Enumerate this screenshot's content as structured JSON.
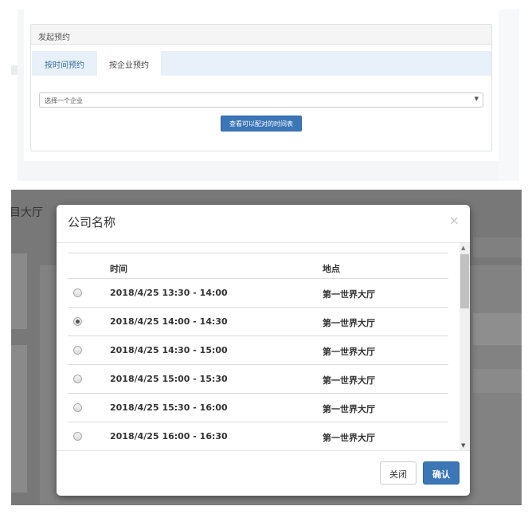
{
  "top": {
    "panel_title": "发起预约",
    "tabs": [
      {
        "label": "按时间预约",
        "active": false
      },
      {
        "label": "按企业预约",
        "active": true
      }
    ],
    "select_placeholder": "选择一个企业",
    "view_button": "查看可以配对的时间表"
  },
  "background": {
    "partial_text": "目大厅"
  },
  "modal": {
    "title": "公司名称",
    "close_icon": "×",
    "headers": {
      "time": "时间",
      "location": "地点"
    },
    "rows": [
      {
        "time": "2018/4/25 13:30 - 14:00",
        "location": "第一世界大厅",
        "selected": false
      },
      {
        "time": "2018/4/25 14:00 - 14:30",
        "location": "第一世界大厅",
        "selected": true
      },
      {
        "time": "2018/4/25 14:30 - 15:00",
        "location": "第一世界大厅",
        "selected": false
      },
      {
        "time": "2018/4/25 15:00 - 15:30",
        "location": "第一世界大厅",
        "selected": false
      },
      {
        "time": "2018/4/25 15:30 - 16:00",
        "location": "第一世界大厅",
        "selected": false
      },
      {
        "time": "2018/4/25 16:00 - 16:30",
        "location": "第一世界大厅",
        "selected": false
      }
    ],
    "close_button": "关闭",
    "confirm_button": "确认"
  },
  "colors": {
    "primary": "#3b76b7",
    "tab_bar": "#e8f0f9",
    "overlay": "#787878"
  }
}
